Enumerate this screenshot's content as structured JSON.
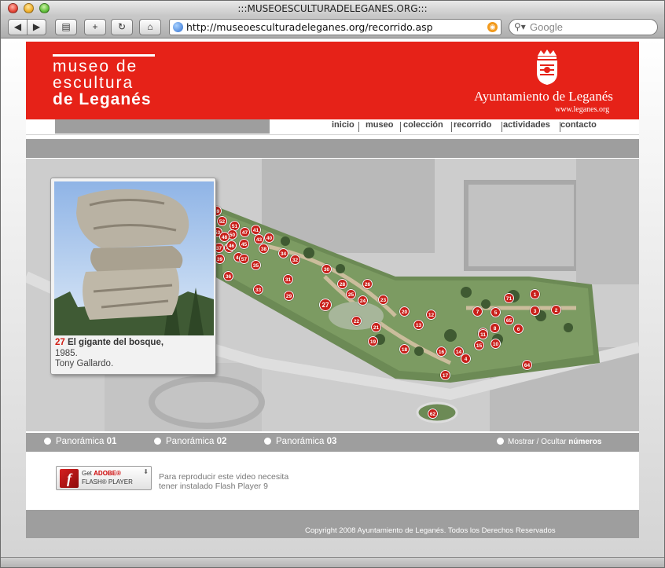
{
  "browser": {
    "title": ":::MUSEOESCULTURADELEGANES.ORG:::",
    "url": "http://museoesculturadeleganes.org/recorrido.asp",
    "search_placeholder": "Google",
    "back_label": "◀",
    "forward_label": "▶",
    "add_label": "+",
    "reload_label": "↻",
    "home_label": "⌂"
  },
  "header": {
    "logo_line1": "museo de",
    "logo_line2": "escultura",
    "logo_line3": "de Leganés",
    "org_name": "Ayuntamiento de Leganés",
    "org_url": "www.leganes.org",
    "brand_color": "#e62218"
  },
  "nav": {
    "items": [
      {
        "label": "inicio"
      },
      {
        "label": "museo"
      },
      {
        "label": "colección"
      },
      {
        "label": "recorrido"
      },
      {
        "label": "actividades"
      },
      {
        "label": "contacto"
      }
    ]
  },
  "sculpture": {
    "number": "27",
    "name": "El gigante del bosque,",
    "year": "1985.",
    "artist": "Tony Gallardo."
  },
  "map_pins": [
    "49",
    "52",
    "51",
    "53",
    "50",
    "47",
    "41",
    "43",
    "40",
    "37",
    "42",
    "39",
    "48",
    "46",
    "45",
    "44",
    "38",
    "35",
    "57",
    "34",
    "32",
    "36",
    "30",
    "31",
    "33",
    "29",
    "28",
    "25",
    "26",
    "24",
    "23",
    "27",
    "22",
    "21",
    "20",
    "19",
    "18",
    "12",
    "13",
    "14",
    "16",
    "15",
    "9",
    "10",
    "11",
    "8",
    "6",
    "7",
    "5",
    "65",
    "3",
    "71",
    "1",
    "2",
    "4",
    "17",
    "64",
    "62"
  ],
  "panoramas": [
    {
      "label": "Panorámica ",
      "num": "01"
    },
    {
      "label": "Panorámica ",
      "num": "02"
    },
    {
      "label": "Panorámica ",
      "num": "03"
    }
  ],
  "toggle": {
    "label": "Mostrar / Ocultar ",
    "bold": "números"
  },
  "flash": {
    "get": "Get",
    "adobe": "ADOBE®",
    "player": "FLASH® PLAYER",
    "message": "Para reproducir este video necesita tener instalado Flash Player 9"
  },
  "footer": {
    "copyright": "Copyright 2008 Ayuntamiento de Leganés. Todos los Derechos Reservados"
  }
}
